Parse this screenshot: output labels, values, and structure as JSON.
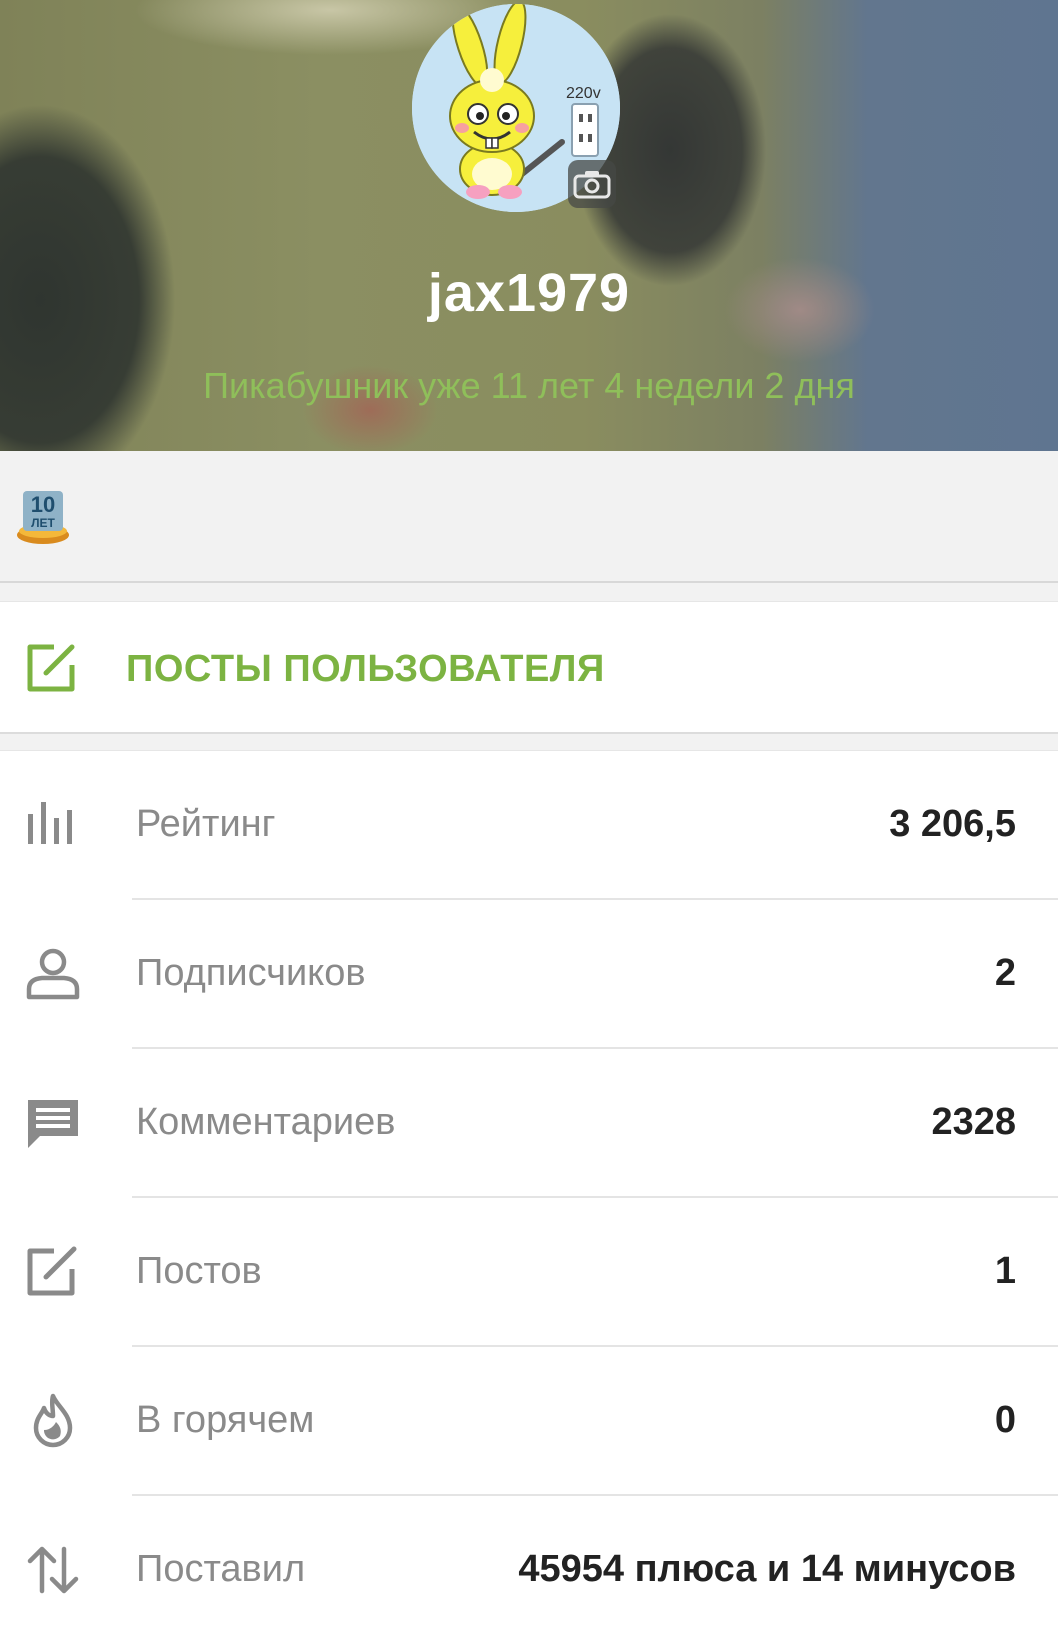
{
  "profile": {
    "username": "jax1979",
    "member_since": "Пикабушник уже 11 лет 4 недели 2 дня",
    "avatar_text": "220v"
  },
  "badges": [
    {
      "name": "10-years-badge",
      "text": "10",
      "subtext": "ЛЕТ"
    }
  ],
  "posts_link": {
    "label": "ПОСТЫ ПОЛЬЗОВАТЕЛЯ"
  },
  "stats": [
    {
      "icon": "bar-chart-icon",
      "label": "Рейтинг",
      "value": "3 206,5"
    },
    {
      "icon": "person-icon",
      "label": "Подписчиков",
      "value": "2"
    },
    {
      "icon": "comment-icon",
      "label": "Комментариев",
      "value": "2328"
    },
    {
      "icon": "edit-icon",
      "label": "Постов",
      "value": "1"
    },
    {
      "icon": "fire-icon",
      "label": "В горячем",
      "value": "0"
    },
    {
      "icon": "arrows-updown-icon",
      "label": "Поставил",
      "value": "45954 плюса и 14 минусов"
    }
  ],
  "colors": {
    "accent_green": "#7cb342",
    "since_green": "#8fbf5a",
    "icon_gray": "#8a8a8a",
    "value_dark": "#222222"
  }
}
